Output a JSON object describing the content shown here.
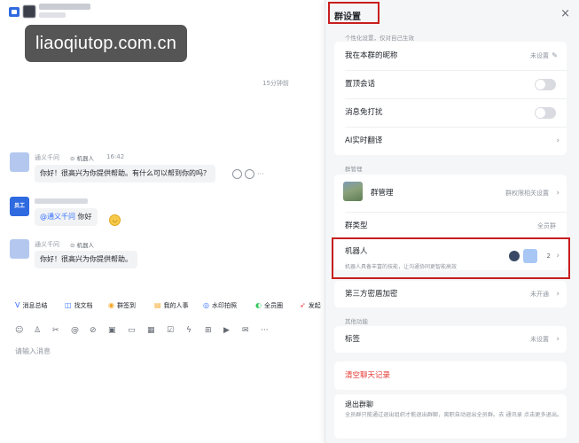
{
  "watermark": "liaoqiutop.com.cn",
  "chat": {
    "timestamp": "15分钟前",
    "messages": [
      {
        "sender": "通义千问",
        "tag": "机器人",
        "time": "16:42",
        "text": "你好！很高兴为你提供帮助。有什么可以帮到你的吗？"
      },
      {
        "user_badge": "员工",
        "mention": "@通义千问",
        "text": "你好"
      },
      {
        "sender": "通义千问",
        "tag": "机器人",
        "text": "你好！很高兴为你提供帮助。"
      }
    ],
    "more_icon": "···",
    "toolbar": [
      {
        "icon": "V",
        "label": "消息总结"
      },
      {
        "icon": "◫",
        "label": "找文档"
      },
      {
        "icon": "◉",
        "label": "群签到"
      },
      {
        "icon": "▤",
        "label": "我的人事"
      },
      {
        "icon": "◎",
        "label": "水印拍照"
      },
      {
        "icon": "◐",
        "label": "全员圈"
      },
      {
        "icon": "➶",
        "label": "发起"
      }
    ],
    "input_placeholder": "请输入消息"
  },
  "panel": {
    "title": "群设置",
    "close": "×",
    "personal_label": "个性化设置，仅对自己生效",
    "nickname_label": "我在本群的昵称",
    "nickname_value": "未设置",
    "pin_label": "置顶会话",
    "mute_label": "消息免打扰",
    "translate_label": "AI实时翻译",
    "group_manage_section": "群管理",
    "group_manage_label": "群管理",
    "group_manage_value": "群权限相关设置",
    "group_type_label": "群类型",
    "group_type_value": "全员群",
    "robot_label": "机器人",
    "robot_sub": "机器人具备丰富的技能，让沟通协同更智能高效",
    "robot_count": "2",
    "third_party_label": "第三方密盾加密",
    "third_party_value": "未开通",
    "other_section": "其他功能",
    "tags_label": "标签",
    "tags_value": "未设置",
    "clear_label": "清空聊天记录",
    "exit_label": "退出群聊",
    "exit_desc": "全员群只能通过退出组织才能退出群聊，离职自动退出全员群。去 通讯录 点击更多退出。"
  }
}
